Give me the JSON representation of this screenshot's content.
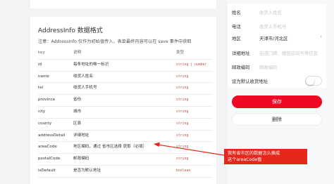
{
  "doc": {
    "title": "AddressInfo 数据格式",
    "note": "注意：AddressInfo 仅作为初始值传入，表单最终内容可以在 save 事件中获取",
    "columns": {
      "key": "key",
      "desc": "说明",
      "type": "类型"
    },
    "rows": [
      {
        "key": "id",
        "desc": "每条地址的唯一标识",
        "type": "string | number"
      },
      {
        "key": "name",
        "desc": "收货人姓名",
        "type": "string"
      },
      {
        "key": "tel",
        "desc": "收货人手机号",
        "type": "string"
      },
      {
        "key": "province",
        "desc": "省份",
        "type": "string"
      },
      {
        "key": "city",
        "desc": "城市",
        "type": "string"
      },
      {
        "key": "county",
        "desc": "区县",
        "type": "string"
      },
      {
        "key": "addressDetail",
        "desc": "详细地址",
        "type": "string"
      },
      {
        "key": "areaCode",
        "desc": "地区编码，通过 省市区选择 获取（必填）",
        "type": "string"
      },
      {
        "key": "postalCode",
        "desc": "邮政编码",
        "type": "string"
      },
      {
        "key": "isDefault",
        "desc": "是否为默认地址",
        "type": "boolean"
      }
    ]
  },
  "form": {
    "fields": [
      {
        "label": "姓名",
        "value": "收货人姓名"
      },
      {
        "label": "电话",
        "value": "收货人手机号"
      },
      {
        "label": "地区",
        "value": "天津市/河北区"
      },
      {
        "label": "详细地址",
        "value": "街道门牌、楼层房间号等信息"
      },
      {
        "label": "邮政编码",
        "value": "邮政编码"
      }
    ],
    "default_label": "设为默认收货地址",
    "default_on": false,
    "save_label": "保存",
    "delete_label": "删除"
  },
  "annotation": {
    "line1": "我有省市区的数据怎么换成",
    "line2": "这个areaCode值"
  },
  "colors": {
    "primary": "#ee0a24",
    "annotation": "#e5281b"
  }
}
